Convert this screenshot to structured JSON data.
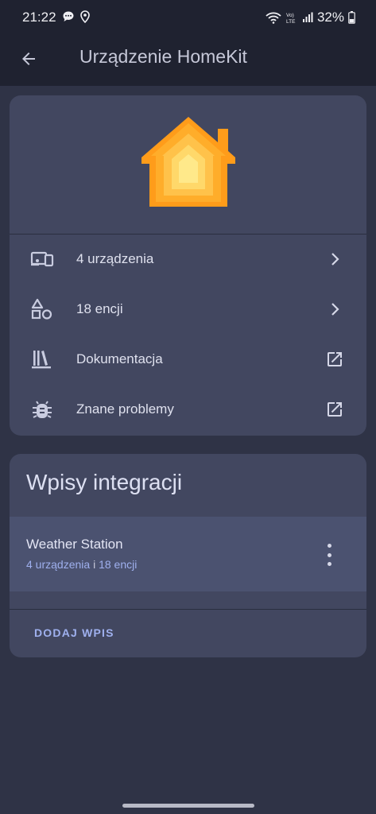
{
  "status_bar": {
    "time": "21:22",
    "battery": "32%"
  },
  "app_bar": {
    "title": "Urządzenie HomeKit"
  },
  "info_card": {
    "rows": [
      {
        "label": "4 urządzenia",
        "icon": "devices-icon",
        "trail": "chevron-right-icon"
      },
      {
        "label": "18 encji",
        "icon": "shapes-icon",
        "trail": "chevron-right-icon"
      },
      {
        "label": "Dokumentacja",
        "icon": "library-books-icon",
        "trail": "open-in-new-icon"
      },
      {
        "label": "Znane problemy",
        "icon": "bug-icon",
        "trail": "open-in-new-icon"
      }
    ]
  },
  "entries_card": {
    "title": "Wpisy integracji",
    "entry": {
      "name": "Weather Station",
      "devices_link": "4 urządzenia",
      "separator": "i",
      "entities_link": "18 encji"
    },
    "add_button": "DODAJ WPIS"
  },
  "colors": {
    "background": "#2f3346",
    "card": "#424760",
    "accent": "#9fb0ee",
    "logo_orange": "#ff9500"
  }
}
